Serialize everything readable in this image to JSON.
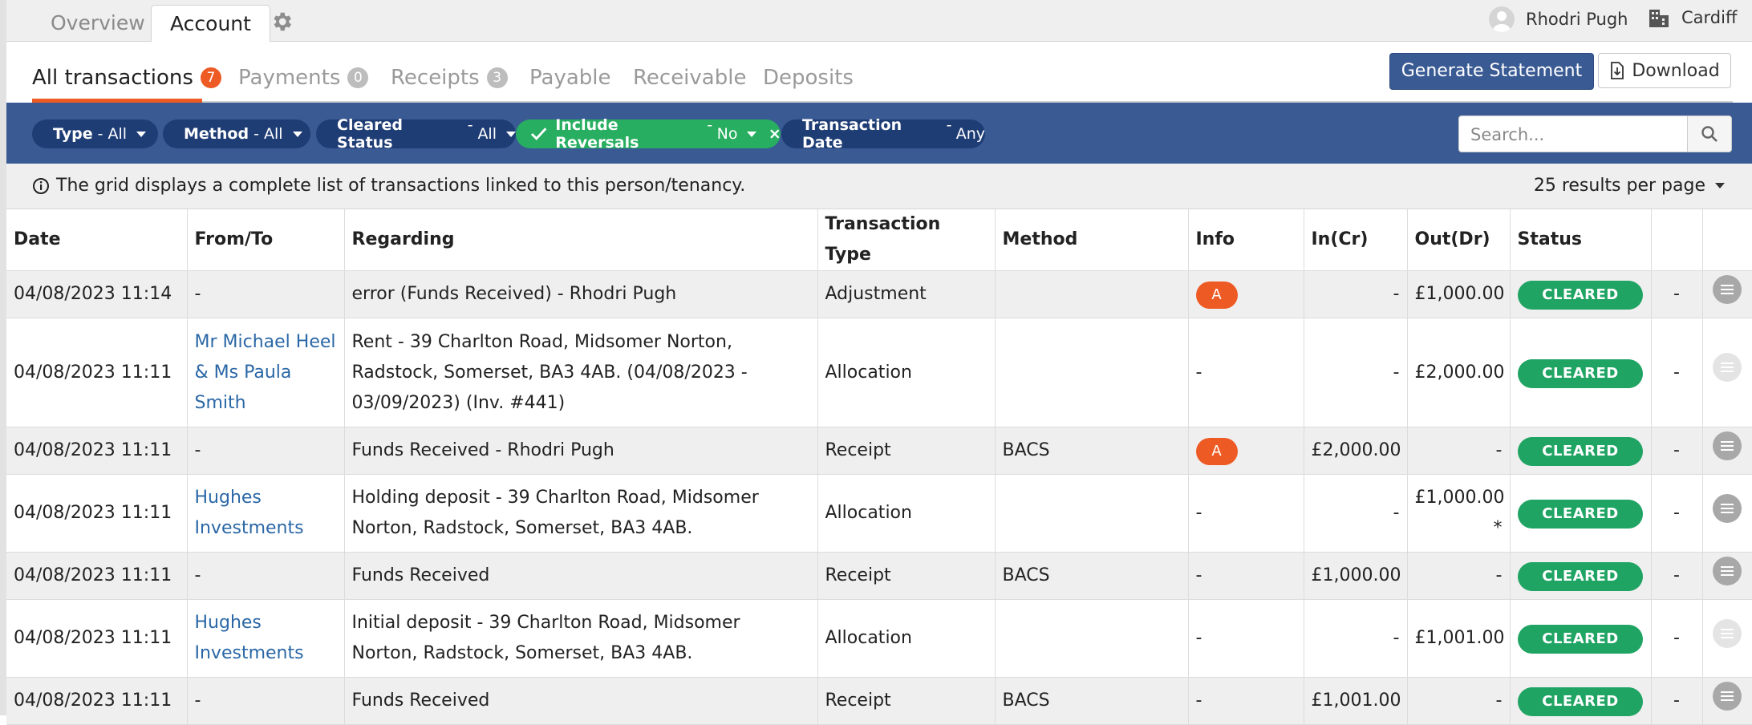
{
  "top_tabs": [
    "Overview",
    "Account"
  ],
  "user": {
    "name": "Rhodri Pugh",
    "branch": "Cardiff"
  },
  "sub_tabs": [
    {
      "label": "All transactions",
      "count": "7"
    },
    {
      "label": "Payments",
      "count": "0"
    },
    {
      "label": "Receipts",
      "count": "3"
    },
    {
      "label": "Payable"
    },
    {
      "label": "Receivable"
    },
    {
      "label": "Deposits"
    }
  ],
  "actions": {
    "generate": "Generate Statement",
    "download": "Download"
  },
  "filters": [
    {
      "key": "Type",
      "value": "All"
    },
    {
      "key": "Method",
      "value": "All"
    },
    {
      "key": "Cleared Status",
      "value": "All"
    },
    {
      "key": "Include Reversals",
      "value": "No"
    },
    {
      "key": "Transaction Date",
      "value": "Any"
    }
  ],
  "search": {
    "placeholder": "Search..."
  },
  "info": {
    "text": "The grid displays a complete list of transactions linked to this person/tenancy.",
    "per_page": "25 results per page"
  },
  "columns": [
    "Date",
    "From/To",
    "Regarding",
    "Transaction Type",
    "Method",
    "Info",
    "In(Cr)",
    "Out(Dr)",
    "Status",
    "",
    ""
  ],
  "rows": [
    {
      "date": "04/08/2023 11:14",
      "from": "-",
      "regarding": "error (Funds Received) - Rhodri Pugh",
      "type": "Adjustment",
      "method": "",
      "info": "A",
      "in": "-",
      "out": "£1,000.00",
      "status": "CLEARED",
      "extra": "-"
    },
    {
      "date": "04/08/2023 11:11",
      "from": "Mr Michael Heel & Ms Paula Smith",
      "regarding": "Rent - 39 Charlton Road, Midsomer Norton, Radstock, Somerset, BA3 4AB. (04/08/2023 - 03/09/2023) (Inv. #441)",
      "type": "Allocation",
      "method": "",
      "info": "-",
      "in": "-",
      "out": "£2,000.00",
      "status": "CLEARED",
      "extra": "-"
    },
    {
      "date": "04/08/2023 11:11",
      "from": "-",
      "regarding": "Funds Received - Rhodri Pugh",
      "type": "Receipt",
      "method": "BACS",
      "info": "A",
      "in": "£2,000.00",
      "out": "-",
      "status": "CLEARED",
      "extra": "-"
    },
    {
      "date": "04/08/2023 11:11",
      "from": "Hughes Investments",
      "regarding": "Holding deposit - 39 Charlton Road, Midsomer Norton, Radstock, Somerset, BA3 4AB.",
      "type": "Allocation",
      "method": "",
      "info": "-",
      "in": "-",
      "out": "£1,000.00 *",
      "status": "CLEARED",
      "extra": "-"
    },
    {
      "date": "04/08/2023 11:11",
      "from": "-",
      "regarding": "Funds Received",
      "type": "Receipt",
      "method": "BACS",
      "info": "-",
      "in": "£1,000.00",
      "out": "-",
      "status": "CLEARED",
      "extra": "-"
    },
    {
      "date": "04/08/2023 11:11",
      "from": "Hughes Investments",
      "regarding": "Initial deposit - 39 Charlton Road, Midsomer Norton, Radstock, Somerset, BA3 4AB.",
      "type": "Allocation",
      "method": "",
      "info": "-",
      "in": "-",
      "out": "£1,001.00",
      "status": "CLEARED",
      "extra": "-"
    },
    {
      "date": "04/08/2023 11:11",
      "from": "-",
      "regarding": "Funds Received",
      "type": "Receipt",
      "method": "BACS",
      "info": "-",
      "in": "£1,001.00",
      "out": "-",
      "status": "CLEARED",
      "extra": "-"
    }
  ]
}
